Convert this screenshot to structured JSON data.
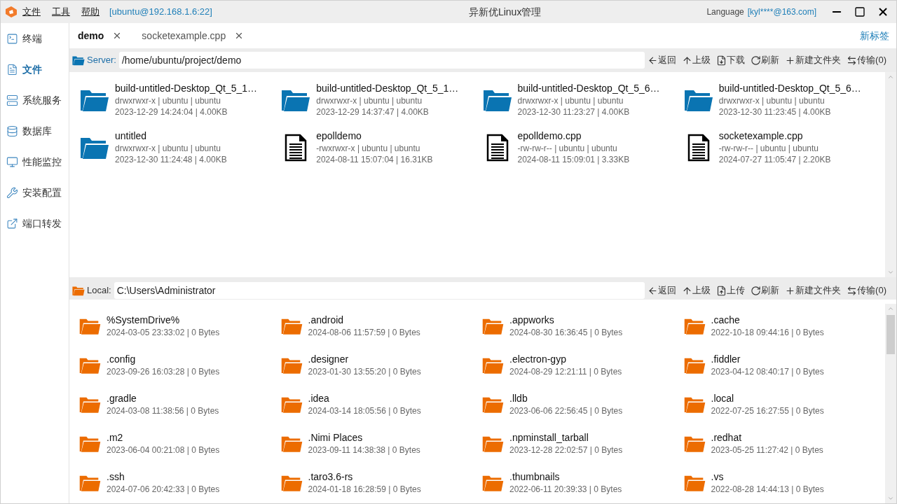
{
  "window": {
    "title": "异新优Linux管理",
    "menu": [
      "文件",
      "工具",
      "帮助"
    ],
    "connection": "[ubuntu@192.168.1.6:22]",
    "language": "Language",
    "account": "[kyl****@163.com]"
  },
  "sidebar": {
    "items": [
      {
        "label": "终端",
        "kind": "terminal",
        "selected": false
      },
      {
        "label": "文件",
        "kind": "file",
        "selected": true
      },
      {
        "label": "系统服务",
        "kind": "server",
        "selected": false
      },
      {
        "label": "数据库",
        "kind": "database",
        "selected": false
      },
      {
        "label": "性能监控",
        "kind": "monitor",
        "selected": false
      },
      {
        "label": "安装配置",
        "kind": "tools",
        "selected": false
      },
      {
        "label": "端口转发",
        "kind": "forward",
        "selected": false
      }
    ]
  },
  "tabs": [
    {
      "label": "demo",
      "selected": true
    },
    {
      "label": "socketexample.cpp",
      "selected": false
    }
  ],
  "new_tab": "新标签",
  "server": {
    "label": "Server:",
    "path": "/home/ubuntu/project/demo",
    "toolbar": [
      {
        "kind": "back",
        "label": "返回"
      },
      {
        "kind": "up",
        "label": "上级"
      },
      {
        "kind": "download",
        "label": "下载"
      },
      {
        "kind": "refresh",
        "label": "刷新"
      },
      {
        "kind": "new-folder",
        "label": "新建文件夹"
      },
      {
        "kind": "transfer",
        "label": "传输(0)"
      }
    ],
    "files": [
      {
        "kind": "folder",
        "name": "build-untitled-Desktop_Qt_5_1…",
        "perms": "drwxrwxr-x | ubuntu | ubuntu",
        "meta": "2023-12-29 14:24:04 | 4.00KB"
      },
      {
        "kind": "folder",
        "name": "build-untitled-Desktop_Qt_5_1…",
        "perms": "drwxrwxr-x | ubuntu | ubuntu",
        "meta": "2023-12-29 14:37:47 | 4.00KB"
      },
      {
        "kind": "folder",
        "name": "build-untitled-Desktop_Qt_5_6…",
        "perms": "drwxrwxr-x | ubuntu | ubuntu",
        "meta": "2023-12-30 11:23:27 | 4.00KB"
      },
      {
        "kind": "folder",
        "name": "build-untitled-Desktop_Qt_5_6…",
        "perms": "drwxrwxr-x | ubuntu | ubuntu",
        "meta": "2023-12-30 11:23:45 | 4.00KB"
      },
      {
        "kind": "folder",
        "name": "untitled",
        "perms": "drwxrwxr-x | ubuntu | ubuntu",
        "meta": "2023-12-30 11:24:48 | 4.00KB"
      },
      {
        "kind": "file",
        "name": "epolldemo",
        "perms": "-rwxrwxr-x | ubuntu | ubuntu",
        "meta": "2024-08-11 15:07:04 | 16.31KB"
      },
      {
        "kind": "file",
        "name": "epolldemo.cpp",
        "perms": "-rw-rw-r-- | ubuntu | ubuntu",
        "meta": "2024-08-11 15:09:01 | 3.33KB"
      },
      {
        "kind": "file",
        "name": "socketexample.cpp",
        "perms": "-rw-rw-r-- | ubuntu | ubuntu",
        "meta": "2024-07-27 11:05:47 | 2.20KB"
      }
    ]
  },
  "local": {
    "label": "Local:",
    "path": "C:\\Users\\Administrator",
    "toolbar": [
      {
        "kind": "back",
        "label": "返回"
      },
      {
        "kind": "up",
        "label": "上级"
      },
      {
        "kind": "upload",
        "label": "上传"
      },
      {
        "kind": "refresh",
        "label": "刷新"
      },
      {
        "kind": "new-folder",
        "label": "新建文件夹"
      },
      {
        "kind": "transfer",
        "label": "传输(0)"
      }
    ],
    "files": [
      {
        "kind": "folder",
        "name": "%SystemDrive%",
        "meta": "2024-03-05 23:33:02 | 0 Bytes"
      },
      {
        "kind": "folder",
        "name": ".android",
        "meta": "2024-08-06 11:57:59 | 0 Bytes"
      },
      {
        "kind": "folder",
        "name": ".appworks",
        "meta": "2024-08-30 16:36:45 | 0 Bytes"
      },
      {
        "kind": "folder",
        "name": ".cache",
        "meta": "2022-10-18 09:44:16 | 0 Bytes"
      },
      {
        "kind": "folder",
        "name": ".config",
        "meta": "2023-09-26 16:03:28 | 0 Bytes"
      },
      {
        "kind": "folder",
        "name": ".designer",
        "meta": "2023-01-30 13:55:20 | 0 Bytes"
      },
      {
        "kind": "folder",
        "name": ".electron-gyp",
        "meta": "2024-08-29 12:21:11 | 0 Bytes"
      },
      {
        "kind": "folder",
        "name": ".fiddler",
        "meta": "2023-04-12 08:40:17 | 0 Bytes"
      },
      {
        "kind": "folder",
        "name": ".gradle",
        "meta": "2024-03-08 11:38:56 | 0 Bytes"
      },
      {
        "kind": "folder",
        "name": ".idea",
        "meta": "2024-03-14 18:05:56 | 0 Bytes"
      },
      {
        "kind": "folder",
        "name": ".lldb",
        "meta": "2023-06-06 22:56:45 | 0 Bytes"
      },
      {
        "kind": "folder",
        "name": ".local",
        "meta": "2022-07-25 16:27:55 | 0 Bytes"
      },
      {
        "kind": "folder",
        "name": ".m2",
        "meta": "2023-06-04 00:21:08 | 0 Bytes"
      },
      {
        "kind": "folder",
        "name": ".Nimi Places",
        "meta": "2023-09-11 14:38:38 | 0 Bytes"
      },
      {
        "kind": "folder",
        "name": ".npminstall_tarball",
        "meta": "2023-12-28 22:02:57 | 0 Bytes"
      },
      {
        "kind": "folder",
        "name": ".redhat",
        "meta": "2023-05-25 11:27:42 | 0 Bytes"
      },
      {
        "kind": "folder",
        "name": ".ssh",
        "meta": "2024-07-06 20:42:33 | 0 Bytes"
      },
      {
        "kind": "folder",
        "name": ".taro3.6-rs",
        "meta": "2024-01-18 16:28:59 | 0 Bytes"
      },
      {
        "kind": "folder",
        "name": ".thumbnails",
        "meta": "2022-06-11 20:39:33 | 0 Bytes"
      },
      {
        "kind": "folder",
        "name": ".vs",
        "meta": "2022-08-28 14:44:13 | 0 Bytes"
      }
    ]
  }
}
